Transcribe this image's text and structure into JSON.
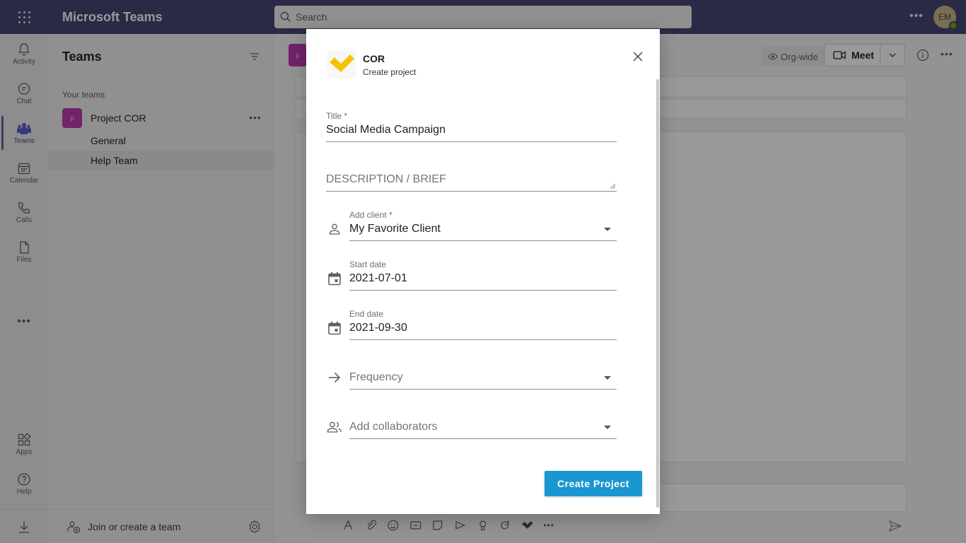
{
  "app": {
    "title": "Microsoft Teams",
    "avatar_initials": "EM"
  },
  "search": {
    "placeholder": "Search"
  },
  "rail": {
    "items": [
      {
        "label": "Activity",
        "icon": "bell-icon"
      },
      {
        "label": "Chat",
        "icon": "chat-icon"
      },
      {
        "label": "Teams",
        "icon": "teams-icon"
      },
      {
        "label": "Calendar",
        "icon": "calendar-icon"
      },
      {
        "label": "Calls",
        "icon": "phone-icon"
      },
      {
        "label": "Files",
        "icon": "file-icon"
      }
    ],
    "apps": {
      "label": "Apps",
      "icon": "apps-icon"
    },
    "help": {
      "label": "Help",
      "icon": "help-icon"
    }
  },
  "teams_panel": {
    "title": "Teams",
    "section_label": "Your teams",
    "team": {
      "avatar_letter": "p",
      "name": "Project COR"
    },
    "channels": [
      "General",
      "Help Team"
    ],
    "join_label": "Join or create a team"
  },
  "channel_header": {
    "avatar_letter": "p",
    "org_wide": "Org-wide",
    "meet_label": "Meet"
  },
  "modal": {
    "app_name": "COR",
    "subtitle": "Create project",
    "fields": {
      "title": {
        "label": "Title *",
        "value": "Social Media Campaign"
      },
      "description": {
        "placeholder": "DESCRIPTION / BRIEF"
      },
      "client": {
        "label": "Add client *",
        "value": "My Favorite Client"
      },
      "start_date": {
        "label": "Start date",
        "value": "2021-07-01"
      },
      "end_date": {
        "label": "End date",
        "value": "2021-09-30"
      },
      "frequency": {
        "placeholder": "Frequency"
      },
      "collaborators": {
        "placeholder": "Add collaborators"
      }
    },
    "submit_label": "Create Project"
  },
  "colors": {
    "teams_bar": "#464775",
    "accent": "#6264a7",
    "logo_yellow": "#f5c400",
    "primary_button": "#1a97d1"
  }
}
